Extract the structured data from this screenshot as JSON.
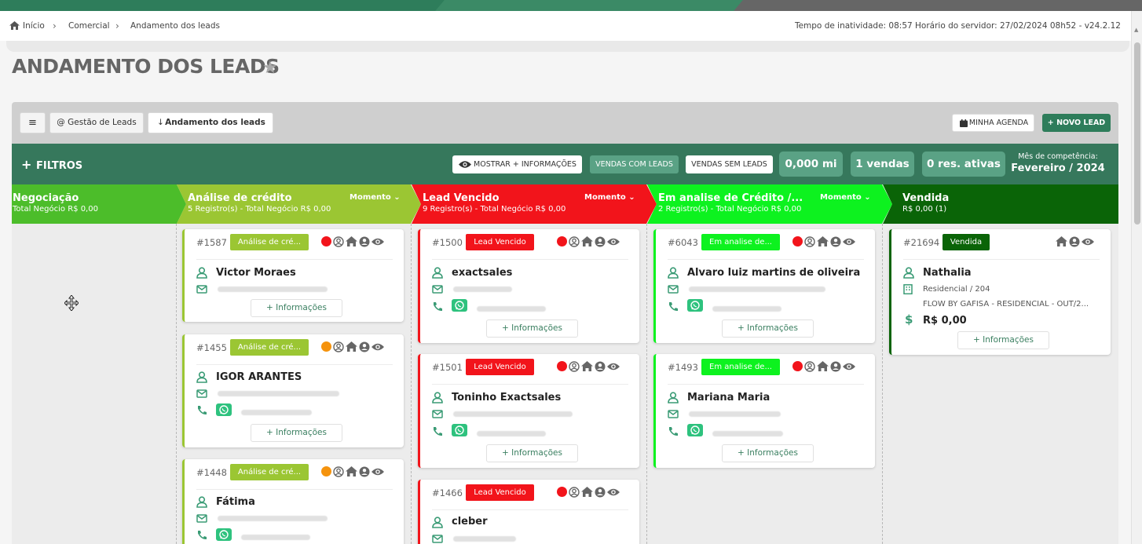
{
  "breadcrumb": {
    "home": "Início",
    "section": "Comercial",
    "current": "Andamento dos leads"
  },
  "server": {
    "info": "Tempo de inatividade: 08:57   Horário do servidor: 27/02/2024 08h52 - v24.2.12"
  },
  "page": {
    "title": "ANDAMENTO DOS LEADS"
  },
  "toolbar": {
    "menu": "≡",
    "gestao": "@ Gestão de Leads",
    "andamento": "Andamento dos leads",
    "agenda": "MINHA AGENDA",
    "novo": "+ NOVO LEAD"
  },
  "filters": {
    "label": "FILTROS",
    "mostrar": "MOSTRAR + INFORMAÇÕES",
    "com": "VENDAS COM LEADS",
    "sem": "VENDAS SEM LEADS",
    "mi": "0,000 mi",
    "vendas": "1 vendas",
    "res": "0 res. ativas",
    "mes_label": "Mês de competência:",
    "mes_value": "Fevereiro / 2024"
  },
  "columns": [
    {
      "title": "Negociação",
      "stats": "Total Negócio R$ 0,00",
      "momento": "",
      "color": "#4cbd2a"
    },
    {
      "title": "Análise de crédito",
      "stats": "5 Registro(s) - Total Negócio R$ 0,00",
      "momento": "Momento",
      "color": "#9bc633"
    },
    {
      "title": "Lead Vencido",
      "stats": "9 Registro(s) - Total Negócio R$ 0,00",
      "momento": "Momento",
      "color": "#f2141b"
    },
    {
      "title": "Em analise de Crédito /...",
      "stats": "2 Registro(s) - Total Negócio R$ 0,00",
      "momento": "Momento",
      "color": "#0df21f"
    },
    {
      "title": "Vendida",
      "stats": "R$ 0,00 (1)",
      "momento": "",
      "color": "#0a6407"
    }
  ],
  "cards": {
    "c1587": {
      "id": "#1587",
      "badge": "Análise de cré...",
      "name": "Victor Moraes",
      "info": "+ Informações"
    },
    "c1455": {
      "id": "#1455",
      "badge": "Análise de cré...",
      "name": "IGOR ARANTES",
      "info": "+ Informações"
    },
    "c1448": {
      "id": "#1448",
      "badge": "Análise de cré...",
      "name": "Fátima"
    },
    "c1500": {
      "id": "#1500",
      "badge": "Lead Vencido",
      "name": "exactsales",
      "info": "+ Informações"
    },
    "c1501": {
      "id": "#1501",
      "badge": "Lead Vencido",
      "name": "Toninho Exactsales",
      "info": "+ Informações"
    },
    "c1466": {
      "id": "#1466",
      "badge": "Lead Vencido",
      "name": "cleber"
    },
    "c6043": {
      "id": "#6043",
      "badge": "Em analise de...",
      "name": "Alvaro luiz martins de oliveira",
      "info": "+ Informações"
    },
    "c1493": {
      "id": "#1493",
      "badge": "Em analise de...",
      "name": "Mariana Maria",
      "info": "+ Informações"
    },
    "c21694": {
      "id": "#21694",
      "badge": "Vendida",
      "name": "Nathalia",
      "unit": "Residencial / 204",
      "project": "FLOW BY GAFISA - RESIDENCIAL - OUT/2...",
      "price": "R$ 0,00",
      "info": "+ Informações"
    }
  },
  "colors": {
    "brand": "#2e7d5b",
    "dot_red": "#f2141b",
    "dot_orange": "#f5930d"
  },
  "icons": [
    "home-icon",
    "chevron-right-icon",
    "star-icon",
    "calendar-icon",
    "plus-icon",
    "eye-icon",
    "person-icon",
    "envelope-icon",
    "phone-icon",
    "whatsapp-icon",
    "building-icon",
    "dollar-icon",
    "move-cursor-icon"
  ]
}
